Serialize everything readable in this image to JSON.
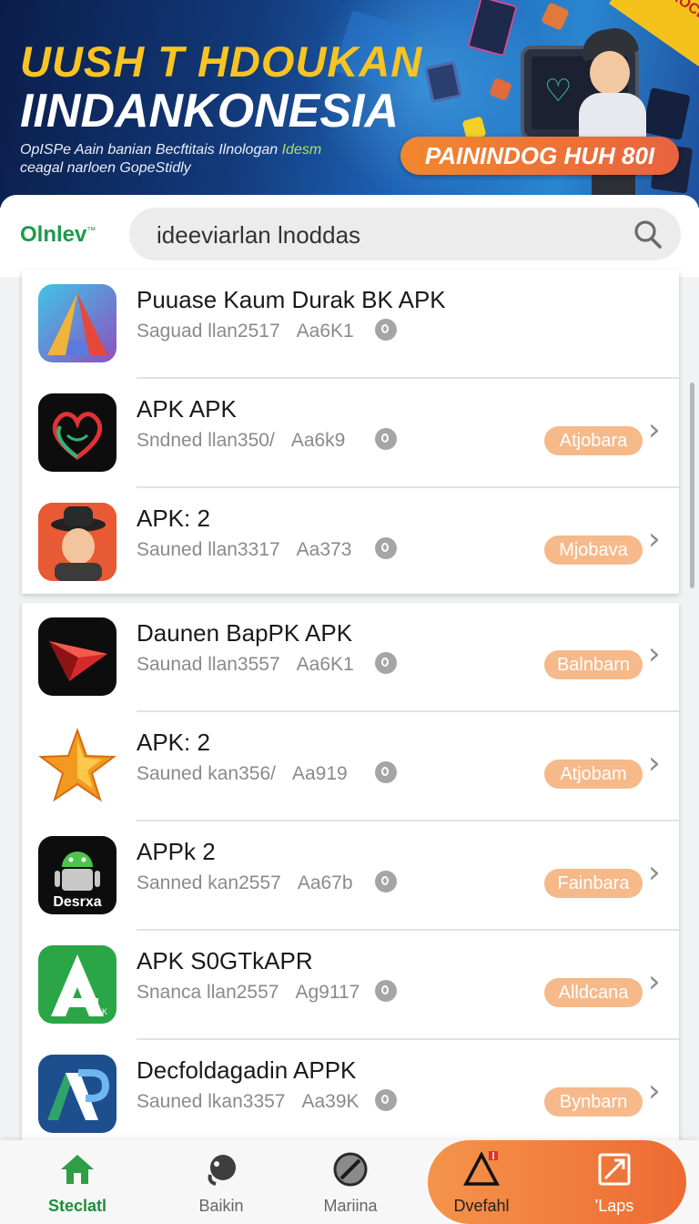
{
  "banner": {
    "title_line1": "UUSH T HDOUKAN",
    "title_line2": "IINDANKONESIA",
    "sub_line1_a": "OpISPe Aain banian Becftitais Ilnologan ",
    "sub_line1_b": "Idesm",
    "sub_line2": "ceagal narloen GopeStidly",
    "promo_button": "PAININDOG HUH 80I",
    "corner_badge": "BHL ROCBS",
    "colors": {
      "title_yellow": "#f7c423",
      "promo": "#ef7a36"
    }
  },
  "header": {
    "brand": "Olnlev",
    "brand_mark": "™",
    "search_value": "ideeviarlan lnoddas",
    "search_icon": "search-icon"
  },
  "apps": [
    {
      "name": "Puuase Kaum Durak BK APK",
      "size": "Saguad llan2517",
      "version": "Aa6K1",
      "action": "",
      "icon": "multicolor-triangle-icon"
    },
    {
      "name": "APK APK",
      "size": "Sndned llan350/",
      "version": "Aa6k9",
      "action": "Atjobara",
      "icon": "heart-face-icon"
    },
    {
      "name": "APK: 2",
      "size": "Sauned llan3317",
      "version": "Aa373",
      "action": "Mjobava",
      "icon": "cartoon-man-icon"
    },
    {
      "name": "Daunen BapPK APK",
      "size": "Saunad llan3557",
      "version": "Aa6K1",
      "action": "Balnbarn",
      "icon": "red-arrow-icon"
    },
    {
      "name": "APK: 2",
      "size": "Sauned kan356/",
      "version": "Aa919",
      "action": "Atjobam",
      "icon": "star-icon"
    },
    {
      "name": "APPk 2",
      "size": "Sanned kan2557",
      "version": "Aa67b",
      "action": "Fainbara",
      "icon": "android-robot-icon",
      "icon_text": "Desrxa"
    },
    {
      "name": "APK S0GTkAPR",
      "size": "Snanca llan2557",
      "version": "Ag9117",
      "action": "Alldcana",
      "icon": "green-a-icon",
      "icon_text": "llopK"
    },
    {
      "name": "Decfoldagadin APPK",
      "size": "Sauned lkan3357",
      "version": "Aa39K",
      "action": "Bynbarn",
      "icon": "blue-ap-icon"
    }
  ],
  "nav": {
    "items": [
      {
        "label": "Steclatl",
        "icon": "home-icon"
      },
      {
        "label": "Baikin",
        "icon": "profile-icon"
      },
      {
        "label": "Mariina",
        "icon": "slash-circle-icon"
      },
      {
        "label": "Dvefahl",
        "icon": "warning-icon"
      },
      {
        "label": "'Laps",
        "icon": "image-edit-icon"
      }
    ],
    "accent": "#1f8d3e",
    "cta_color": "#ef7a36"
  }
}
